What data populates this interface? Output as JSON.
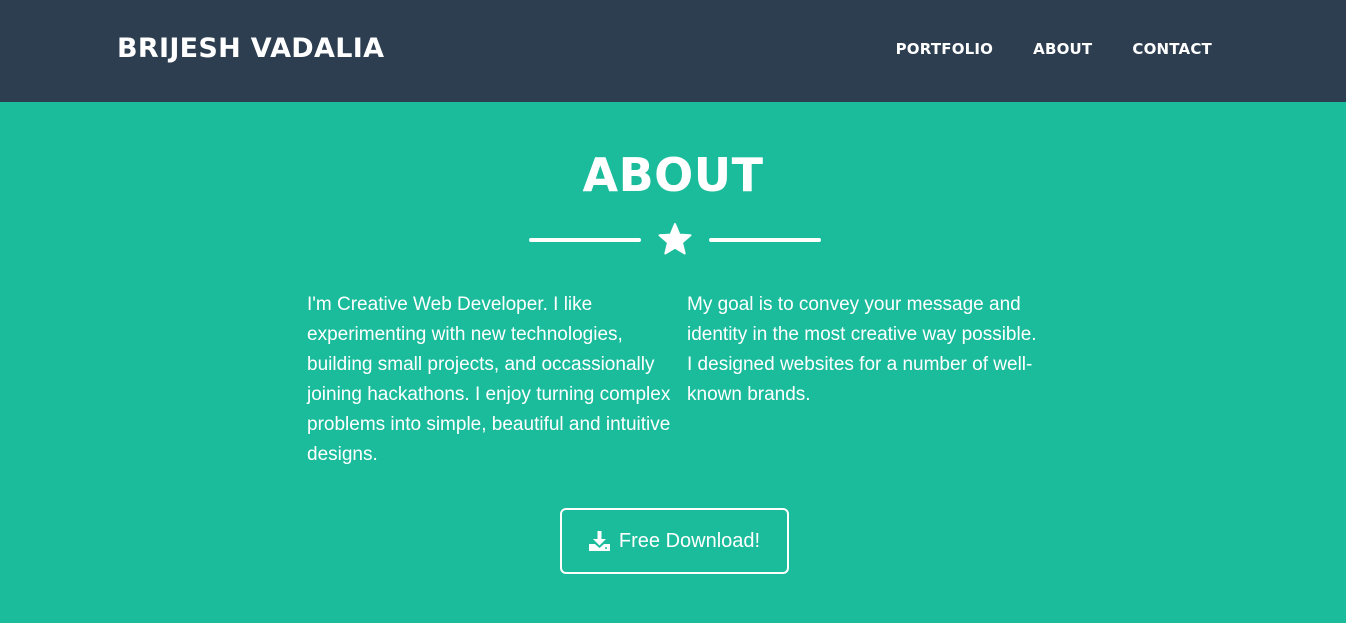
{
  "header": {
    "brand": "BRIJESH VADALIA",
    "nav": [
      {
        "label": "PORTFOLIO"
      },
      {
        "label": "ABOUT"
      },
      {
        "label": "CONTACT"
      }
    ]
  },
  "about": {
    "title": "ABOUT",
    "divider_icon": "star-icon",
    "paragraphs": [
      "I'm Creative Web Developer. I like experimenting with new technologies, building small projects, and occassionally joining hackathons. I enjoy turning complex problems into simple, beautiful and intuitive designs.",
      "My goal is to convey your message and identity in the most creative way possible. I designed websites for a number of well-known brands."
    ],
    "download_button": {
      "label": "Free Download!",
      "icon": "download-icon"
    }
  },
  "colors": {
    "navbar": "#2c3e50",
    "section": "#1abc9c",
    "text": "#ffffff"
  }
}
